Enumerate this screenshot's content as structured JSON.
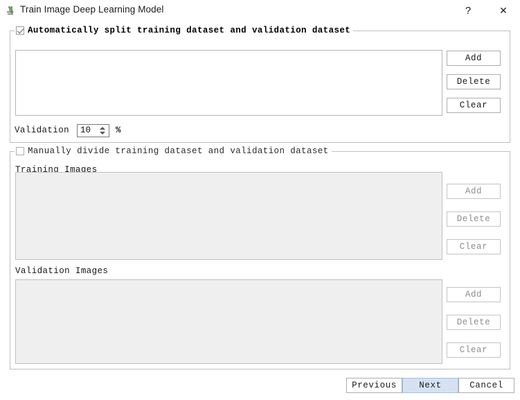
{
  "window": {
    "title": "Train Image Deep Learning Model",
    "icon": "app-microscope-icon",
    "help_label": "?",
    "close_label": "✕"
  },
  "auto_section": {
    "checkbox_label": "Automatically split training dataset and validation dataset",
    "checked": true,
    "enabled": true,
    "list_items": [],
    "buttons": {
      "add": "Add",
      "delete": "Delete",
      "clear": "Clear"
    },
    "validation": {
      "label": "Validation",
      "value": "10",
      "unit": "%"
    }
  },
  "manual_section": {
    "checkbox_label": "Manually divide training dataset and validation dataset",
    "checked": false,
    "enabled": false,
    "training": {
      "label": "Training Images",
      "list_items": [],
      "buttons": {
        "add": "Add",
        "delete": "Delete",
        "clear": "Clear"
      }
    },
    "validation": {
      "label": "Validation Images",
      "list_items": [],
      "buttons": {
        "add": "Add",
        "delete": "Delete",
        "clear": "Clear"
      }
    }
  },
  "footer": {
    "previous": "Previous",
    "next": "Next",
    "cancel": "Cancel",
    "default_button": "Next"
  },
  "colors": {
    "default_button_fill": "#d6e2f2",
    "default_button_border": "#a6bdda",
    "disabled_field_fill": "#efefef",
    "border": "#bfbfbf",
    "disabled_text": "#8e8e8e"
  }
}
